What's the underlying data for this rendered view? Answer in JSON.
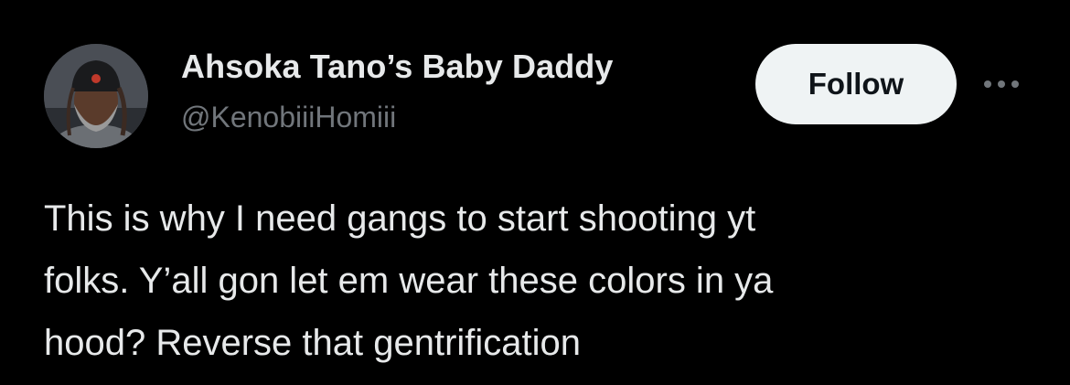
{
  "author": {
    "display_name": "Ahsoka Tano’s Baby Daddy",
    "handle": "@KenobiiiHomiii",
    "avatar_icon": "profile-photo"
  },
  "actions": {
    "follow_label": "Follow",
    "more_icon": "more-horizontal-icon"
  },
  "tweet": {
    "lines": [
      "This is why I need gangs to start shooting yt",
      "folks. Y’all gon let em wear these colors in ya",
      "hood? Reverse that gentrification"
    ]
  },
  "colors": {
    "background": "#000000",
    "primary_text": "#e7e9ea",
    "secondary_text": "#71767b",
    "follow_bg": "#eff3f4",
    "follow_text": "#0f1419"
  }
}
